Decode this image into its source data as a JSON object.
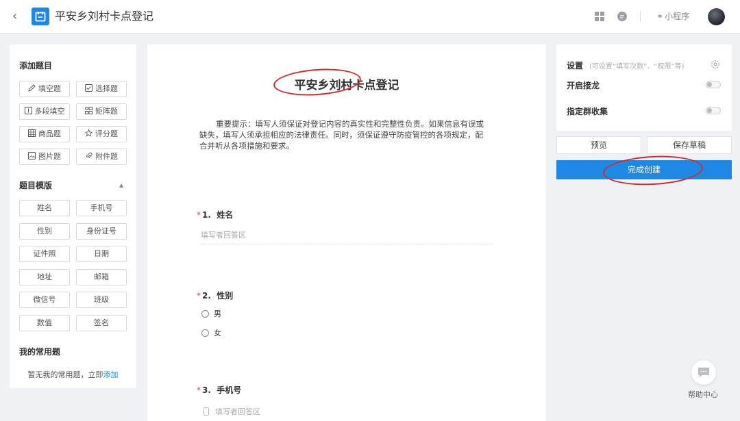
{
  "header": {
    "title": "平安乡刘村卡点登记",
    "mini_program": "小程序"
  },
  "left": {
    "add_title": "添加题目",
    "question_types": [
      "填空题",
      "选择题",
      "多段填空",
      "矩阵题",
      "商品题",
      "评分题",
      "图片题",
      "附件题"
    ],
    "template_title": "题目模版",
    "templates": [
      "姓名",
      "手机号",
      "性别",
      "身份证号",
      "证件照",
      "日期",
      "地址",
      "邮箱",
      "微信号",
      "班级",
      "数值",
      "签名"
    ],
    "common_title": "我的常用题",
    "common_empty": "暂无我的常用题，立即",
    "common_add": "添加"
  },
  "form": {
    "title": "平安乡刘村卡点登记",
    "notice": "重要提示：填写人须保证对登记内容的真实性和完整性负责。如果信息有误或缺失，填写人须承担相应的法律责任。同时，须保证遵守防疫管控的各项规定，配合并听从各项措施和要求。",
    "questions": [
      {
        "required": "*",
        "num": "1.",
        "label": "姓名",
        "placeholder": "填写者回答区"
      },
      {
        "required": "*",
        "num": "2.",
        "label": "性别",
        "options": [
          "男",
          "女"
        ]
      },
      {
        "required": "*",
        "num": "3.",
        "label": "手机号",
        "placeholder": "填写者回答区"
      }
    ]
  },
  "right": {
    "settings_title": "设置",
    "settings_hint": "(可设置“填写次数”、“权限”等)",
    "relay_label": "开启接龙",
    "group_label": "指定群收集",
    "preview": "预览",
    "save_draft": "保存草稿",
    "finish": "完成创建"
  },
  "help": {
    "label": "帮助中心"
  },
  "colors": {
    "primary": "#1e88e5",
    "annotation": "#d62a2a"
  }
}
